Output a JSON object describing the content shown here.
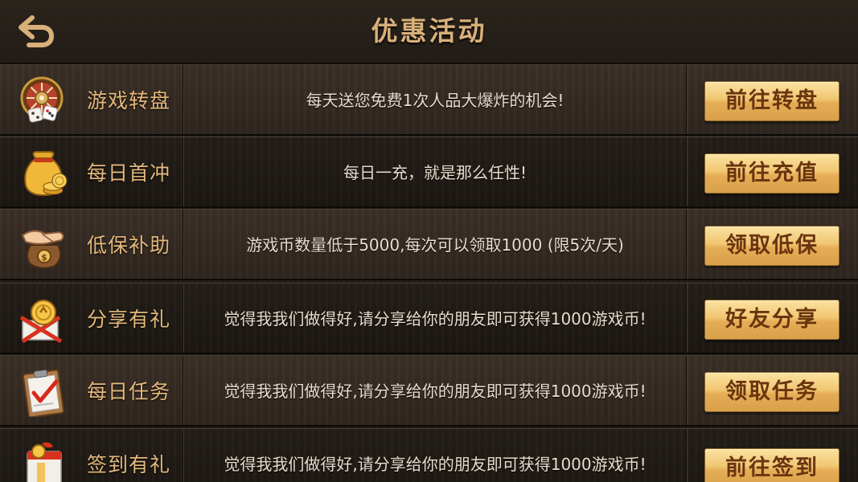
{
  "header": {
    "title": "优惠活动"
  },
  "rows": [
    {
      "name": "游戏转盘",
      "desc": "每天送您免费1次人品大爆炸的机会!",
      "action": "前往转盘",
      "icon": "roulette-icon"
    },
    {
      "name": "每日首冲",
      "desc": "每日一充，就是那么任性!",
      "action": "前往充值",
      "icon": "money-bag-icon"
    },
    {
      "name": "低保补助",
      "desc": "游戏币数量低于5000,每次可以领取1000 (限5次/天)",
      "action": "领取低保",
      "icon": "handshake-coin-icon"
    },
    {
      "name": "分享有礼",
      "desc": "觉得我我们做得好,请分享给你的朋友即可获得1000游戏币!",
      "action": "好友分享",
      "icon": "gift-coin-icon"
    },
    {
      "name": "每日任务",
      "desc": "觉得我我们做得好,请分享给你的朋友即可获得1000游戏币!",
      "action": "领取任务",
      "icon": "clipboard-check-icon"
    },
    {
      "name": "签到有礼",
      "desc": "觉得我我们做得好,请分享给你的朋友即可获得1000游戏币!",
      "action": "前往签到",
      "icon": "calendar-gift-icon"
    }
  ],
  "colors": {
    "title": "#d9b07a",
    "row_name": "#e4b87c",
    "button_text": "#6a3410",
    "button_gold": "#f0c671"
  }
}
